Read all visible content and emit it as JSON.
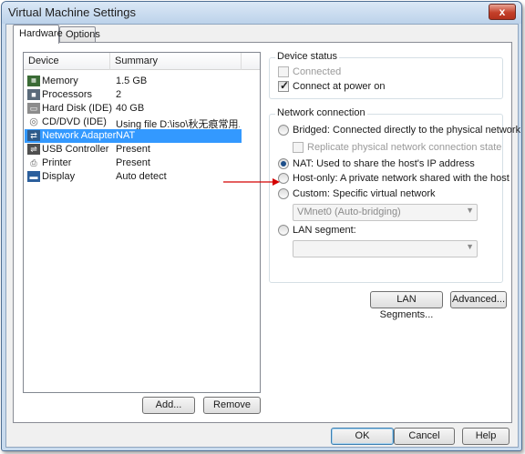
{
  "window": {
    "title": "Virtual Machine Settings",
    "close_glyph": "x"
  },
  "tabs": [
    {
      "label": "Hardware"
    },
    {
      "label": "Options"
    }
  ],
  "device_list": {
    "headers": {
      "device": "Device",
      "summary": "Summary"
    },
    "rows": [
      {
        "device": "Memory",
        "summary": "1.5 GB",
        "icon": "memory-icon"
      },
      {
        "device": "Processors",
        "summary": "2",
        "icon": "processor-icon"
      },
      {
        "device": "Hard Disk (IDE)",
        "summary": "40 GB",
        "icon": "hard-disk-icon"
      },
      {
        "device": "CD/DVD (IDE)",
        "summary": "Using file D:\\iso\\秋无痕常用...",
        "icon": "cd-dvd-icon"
      },
      {
        "device": "Network Adapter",
        "summary": "NAT",
        "icon": "network-adapter-icon",
        "selected": true
      },
      {
        "device": "USB Controller",
        "summary": "Present",
        "icon": "usb-controller-icon"
      },
      {
        "device": "Printer",
        "summary": "Present",
        "icon": "printer-icon"
      },
      {
        "device": "Display",
        "summary": "Auto detect",
        "icon": "display-icon"
      }
    ]
  },
  "list_buttons": {
    "add": "Add...",
    "remove": "Remove"
  },
  "device_status": {
    "title": "Device status",
    "connected": {
      "label": "Connected",
      "checked": false,
      "enabled": false
    },
    "connect_at_power_on": {
      "label": "Connect at power on",
      "checked": true,
      "enabled": true
    }
  },
  "network_connection": {
    "title": "Network connection",
    "bridged": {
      "label": "Bridged: Connected directly to the physical network",
      "selected": false
    },
    "replicate": {
      "label": "Replicate physical network connection state",
      "checked": false,
      "enabled": false
    },
    "nat": {
      "label": "NAT: Used to share the host's IP address",
      "selected": true
    },
    "host_only": {
      "label": "Host-only: A private network shared with the host",
      "selected": false
    },
    "custom": {
      "label": "Custom: Specific virtual network",
      "selected": false
    },
    "custom_select": {
      "value": "VMnet0 (Auto-bridging)",
      "enabled": false
    },
    "lan_segment": {
      "label": "LAN segment:",
      "selected": false
    },
    "lan_select": {
      "value": "",
      "enabled": false
    }
  },
  "right_buttons": {
    "lan_segments": "LAN Segments...",
    "advanced": "Advanced..."
  },
  "dialog_buttons": {
    "ok": "OK",
    "cancel": "Cancel",
    "help": "Help"
  },
  "colors": {
    "selection": "#3399ff",
    "annotation_arrow": "#d40000",
    "title_bar": "#c9dbee",
    "close_button": "#c4402a"
  }
}
